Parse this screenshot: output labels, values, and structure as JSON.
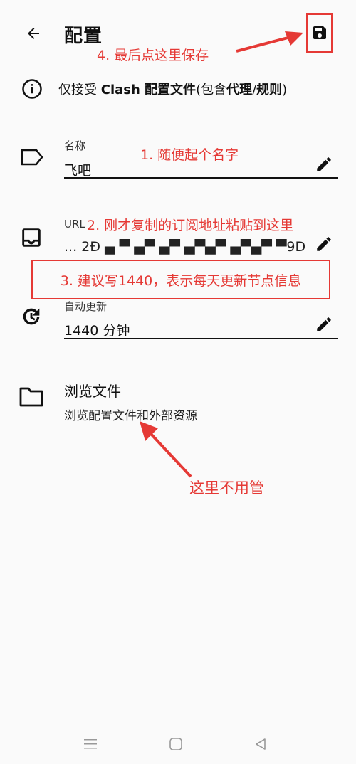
{
  "toolbar": {
    "title": "配置"
  },
  "info": {
    "prefix": "仅接受 ",
    "bold1": "Clash 配置文件",
    "mid": "(包含",
    "bold2": "代理",
    "sep": "/",
    "bold3": "规则",
    "suffix": ")"
  },
  "fields": {
    "name": {
      "label": "名称",
      "value": "飞吧"
    },
    "url": {
      "label": "URL",
      "value": "...        2Ð ▄ ▀  ▄▀  ▄▀ ▄▀▄▀ ▄▀▄▀  ▀9D"
    },
    "update": {
      "label": "自动更新",
      "value": "1440 分钟"
    }
  },
  "browse": {
    "title": "浏览文件",
    "subtitle": "浏览配置文件和外部资源"
  },
  "annotations": {
    "step1": "1. 随便起个名字",
    "step2": "2. 刚才复制的订阅地址粘贴到这里",
    "step3": "3. 建议写1440，表示每天更新节点信息",
    "step4": "4. 最后点这里保存",
    "note": "这里不用管"
  },
  "colors": {
    "accent": "#e53935",
    "text": "#111111",
    "background": "#fafafa"
  },
  "icons": [
    "back-arrow-icon",
    "save-icon",
    "info-icon",
    "label-icon",
    "inbox-icon",
    "update-icon",
    "folder-icon",
    "pencil-icon",
    "menu-icon",
    "home-icon",
    "back-icon"
  ]
}
